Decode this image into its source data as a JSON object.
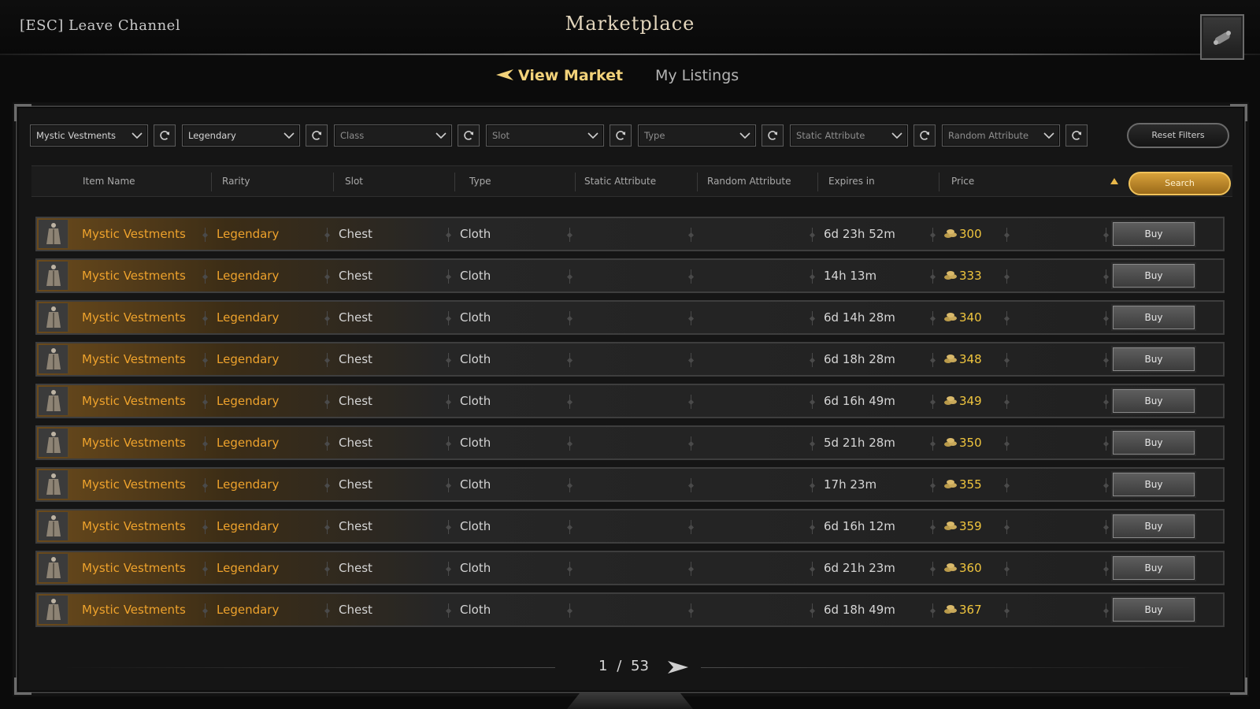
{
  "header": {
    "leave_label": "[ESC] Leave Channel",
    "title": "Marketplace"
  },
  "tabs": [
    {
      "label": "View Market",
      "active": true
    },
    {
      "label": "My Listings",
      "active": false
    }
  ],
  "filters": {
    "name": "Mystic Vestments",
    "rarity": "Legendary",
    "class": "Class",
    "slot": "Slot",
    "type": "Type",
    "static_attribute": "Static Attribute",
    "random_attribute": "Random Attribute",
    "reset_label": "Reset Filters"
  },
  "columns": [
    "Item Name",
    "Rarity",
    "Slot",
    "Type",
    "Static Attribute",
    "Random Attribute",
    "Expires in",
    "Price"
  ],
  "search_label": "Search",
  "buy_label": "Buy",
  "listings": [
    {
      "name": "Mystic Vestments",
      "rarity": "Legendary",
      "slot": "Chest",
      "type": "Cloth",
      "expires": "6d 23h 52m",
      "price": "300"
    },
    {
      "name": "Mystic Vestments",
      "rarity": "Legendary",
      "slot": "Chest",
      "type": "Cloth",
      "expires": "14h 13m",
      "price": "333"
    },
    {
      "name": "Mystic Vestments",
      "rarity": "Legendary",
      "slot": "Chest",
      "type": "Cloth",
      "expires": "6d 14h 28m",
      "price": "340"
    },
    {
      "name": "Mystic Vestments",
      "rarity": "Legendary",
      "slot": "Chest",
      "type": "Cloth",
      "expires": "6d 18h 28m",
      "price": "348"
    },
    {
      "name": "Mystic Vestments",
      "rarity": "Legendary",
      "slot": "Chest",
      "type": "Cloth",
      "expires": "6d 16h 49m",
      "price": "349"
    },
    {
      "name": "Mystic Vestments",
      "rarity": "Legendary",
      "slot": "Chest",
      "type": "Cloth",
      "expires": "5d 21h 28m",
      "price": "350"
    },
    {
      "name": "Mystic Vestments",
      "rarity": "Legendary",
      "slot": "Chest",
      "type": "Cloth",
      "expires": "17h 23m",
      "price": "355"
    },
    {
      "name": "Mystic Vestments",
      "rarity": "Legendary",
      "slot": "Chest",
      "type": "Cloth",
      "expires": "6d 16h 12m",
      "price": "359"
    },
    {
      "name": "Mystic Vestments",
      "rarity": "Legendary",
      "slot": "Chest",
      "type": "Cloth",
      "expires": "6d 21h 23m",
      "price": "360"
    },
    {
      "name": "Mystic Vestments",
      "rarity": "Legendary",
      "slot": "Chest",
      "type": "Cloth",
      "expires": "6d 18h 49m",
      "price": "367"
    }
  ],
  "pagination": {
    "current": "1",
    "separator": "/",
    "total": "53"
  },
  "colors": {
    "gold": "#eea22c",
    "price": "#f0c53e",
    "accent": "#f2d27a"
  }
}
